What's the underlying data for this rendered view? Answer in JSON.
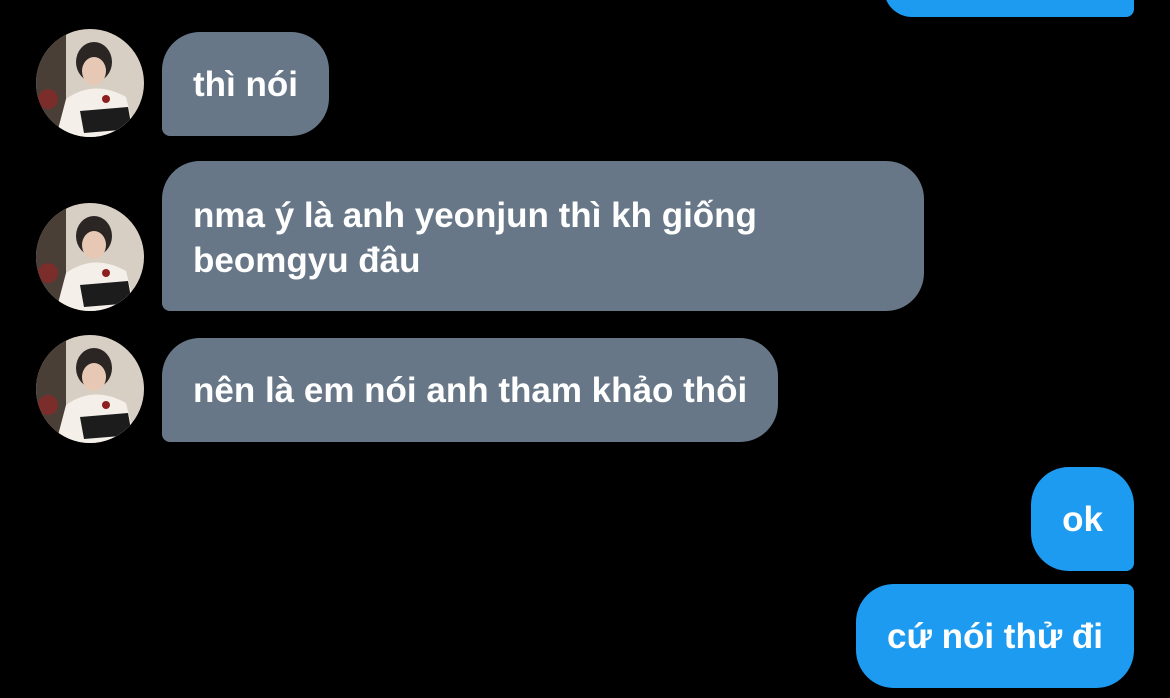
{
  "conversation": {
    "colors": {
      "background": "#000000",
      "received_bubble": "#677787",
      "sent_bubble": "#1d9bf0",
      "text": "#ffffff"
    },
    "messages": [
      {
        "direction": "sent",
        "text": ""
      },
      {
        "direction": "received",
        "text": "thì nói"
      },
      {
        "direction": "received",
        "text": "nma ý là anh yeonjun thì kh giống beomgyu đâu"
      },
      {
        "direction": "received",
        "text": "nên là em nói anh tham khảo thôi"
      },
      {
        "direction": "sent",
        "text": "ok"
      },
      {
        "direction": "sent",
        "text": "cứ nói thử đi"
      }
    ]
  }
}
